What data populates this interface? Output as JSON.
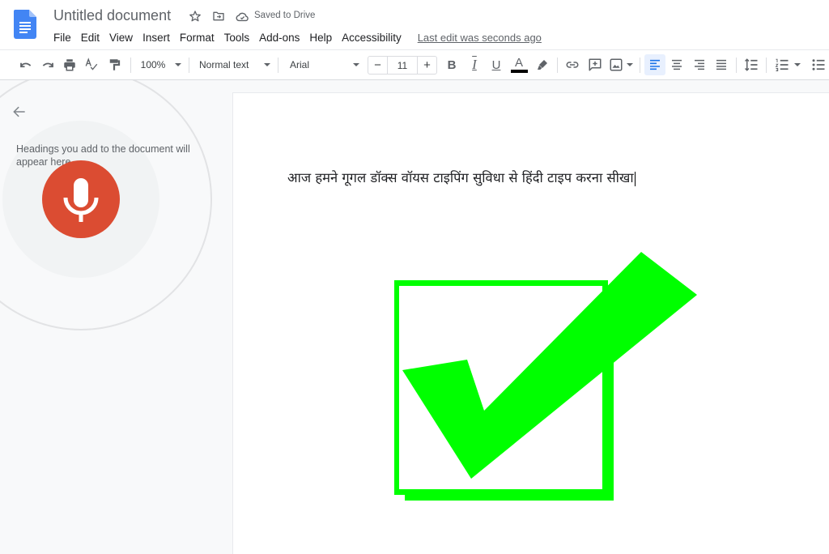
{
  "app": {
    "name": "Google Docs",
    "document_title": "Untitled document",
    "save_status": "Saved to Drive",
    "title_icons": [
      "star-icon",
      "move-to-folder-icon",
      "cloud-saved-icon"
    ]
  },
  "menu": {
    "items": [
      "File",
      "Edit",
      "View",
      "Insert",
      "Format",
      "Tools",
      "Add-ons",
      "Help",
      "Accessibility"
    ],
    "last_edit": "Last edit was seconds ago"
  },
  "toolbar": {
    "zoom": "100%",
    "style": "Normal text",
    "font": "Arial",
    "font_size": "11",
    "decrease_label": "−",
    "increase_label": "+",
    "text_color": "#000000",
    "active_alignment": "left",
    "buttons": [
      "undo",
      "redo",
      "print",
      "spell-check",
      "paint-format",
      "bold",
      "italic",
      "underline",
      "text-color",
      "highlight",
      "link",
      "comment",
      "image",
      "align-left",
      "align-center",
      "align-right",
      "justify",
      "line-spacing",
      "numbered-list",
      "bulleted-list"
    ],
    "bold_label": "B",
    "italic_label": "I",
    "underline_label": "U",
    "text_color_label": "A"
  },
  "outline_panel": {
    "hint": "Headings you add to the document will appear here.",
    "voice_typing": {
      "state": "listening",
      "mic_color": "#db4c32"
    }
  },
  "document": {
    "body_text": "आज हमने गूगल डॉक्स वॉयस टाइपिंग सुविधा से हिंदी टाइप करना सीखा",
    "image": {
      "description": "green checkmark in a box",
      "color": "#00ff00"
    }
  },
  "colors": {
    "accent": "#1a73e8",
    "docs_blue": "#4285f4",
    "active_bg": "#e8f0fe"
  }
}
